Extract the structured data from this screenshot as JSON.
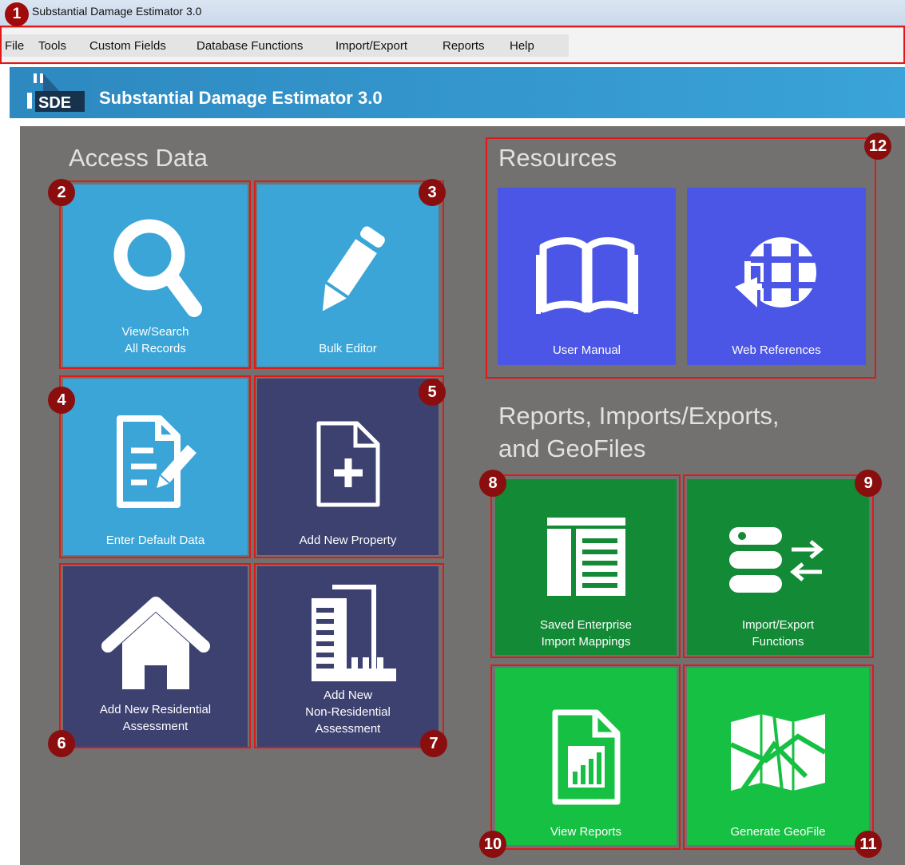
{
  "window": {
    "title": "Substantial Damage Estimator 3.0"
  },
  "menu": [
    "File",
    "Tools",
    "Custom Fields",
    "Database Functions",
    "Import/Export",
    "Reports",
    "Help"
  ],
  "banner": {
    "logo_text": "SDE",
    "title": "Substantial Damage Estimator 3.0"
  },
  "sections": {
    "access": "Access Data",
    "resources": "Resources",
    "reports_line1": "Reports, Imports/Exports,",
    "reports_line2": "and GeoFiles"
  },
  "tiles": {
    "view_search": {
      "line1": "View/Search",
      "line2": "All Records",
      "icon": "search-icon",
      "color": "#3aa5d6"
    },
    "bulk_editor": {
      "line1": "Bulk Editor",
      "icon": "pencil-icon",
      "color": "#3aa5d6"
    },
    "enter_default": {
      "line1": "Enter Default Data",
      "icon": "document-edit-icon",
      "color": "#3aa5d6"
    },
    "add_property": {
      "line1": "Add New Property",
      "icon": "add-file-icon",
      "color": "#3c4170"
    },
    "add_residential": {
      "line1": "Add New Residential",
      "line2": "Assessment",
      "icon": "house-icon",
      "color": "#3c4170"
    },
    "add_nonresidential": {
      "line1": "Add New",
      "line2": "Non-Residential",
      "line3": "Assessment",
      "icon": "buildings-icon",
      "color": "#3c4170"
    },
    "user_manual": {
      "line1": "User Manual",
      "icon": "book-icon",
      "color": "#4b55e6"
    },
    "web_references": {
      "line1": "Web References",
      "icon": "globe-icon",
      "color": "#4b55e6"
    },
    "saved_mappings": {
      "line1": "Saved Enterprise",
      "line2": "Import Mappings",
      "icon": "table-icon",
      "color": "#138a35"
    },
    "import_export": {
      "line1": "Import/Export",
      "line2": "Functions",
      "icon": "database-transfer-icon",
      "color": "#138a35"
    },
    "view_reports": {
      "line1": "View Reports",
      "icon": "report-icon",
      "color": "#16c042"
    },
    "generate_geofile": {
      "line1": "Generate GeoFile",
      "icon": "map-icon",
      "color": "#16c042"
    }
  },
  "badges": [
    "1",
    "2",
    "3",
    "4",
    "5",
    "6",
    "7",
    "8",
    "9",
    "10",
    "11",
    "12"
  ]
}
